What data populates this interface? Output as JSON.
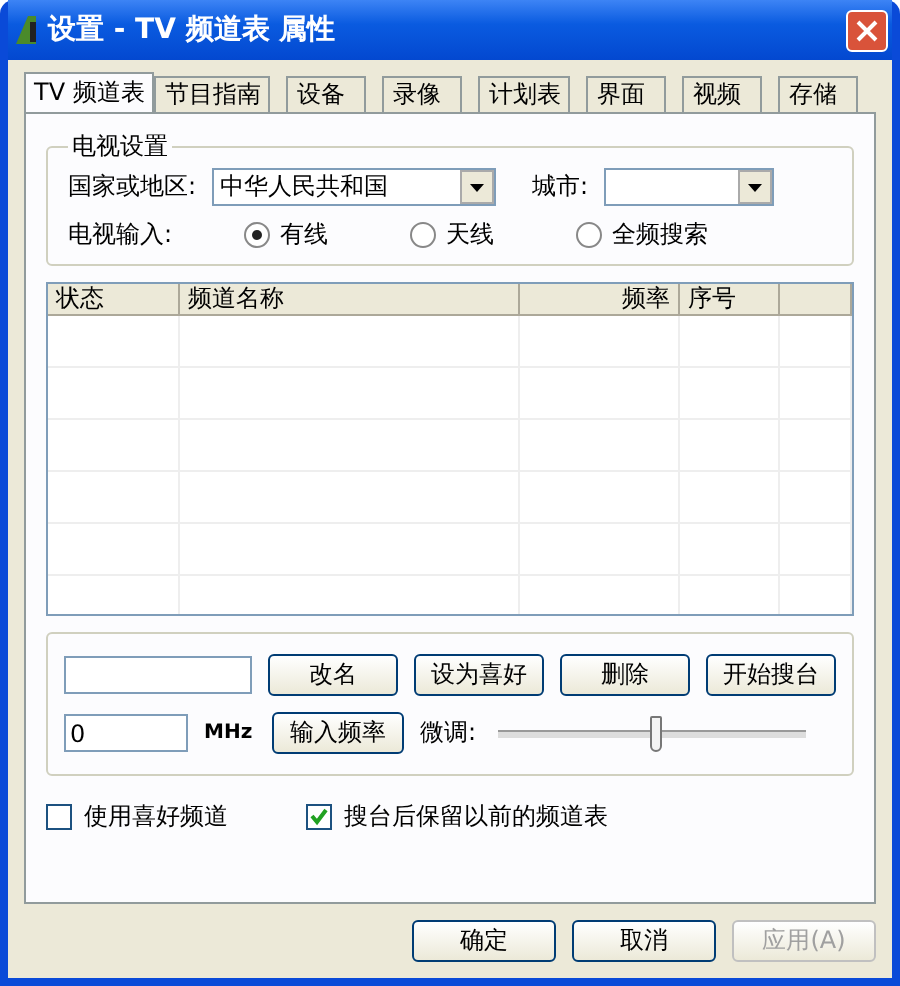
{
  "window": {
    "title": "设置 - TV 频道表 属性"
  },
  "tabs": [
    {
      "label": "TV 频道表",
      "selected": true
    },
    {
      "label": "节目指南",
      "selected": false
    },
    {
      "label": "设备",
      "selected": false
    },
    {
      "label": "录像",
      "selected": false
    },
    {
      "label": "计划表",
      "selected": false
    },
    {
      "label": "界面",
      "selected": false
    },
    {
      "label": "视频",
      "selected": false
    },
    {
      "label": "存储",
      "selected": false
    }
  ],
  "tv_settings": {
    "title": "电视设置",
    "country_label": "国家或地区:",
    "country_value": "中华人民共和国",
    "city_label": "城市:",
    "input_label": "电视输入:",
    "inputs": [
      {
        "label": "有线",
        "selected": true
      },
      {
        "label": "天线",
        "selected": false
      },
      {
        "label": "全频搜索",
        "selected": false
      }
    ]
  },
  "table": {
    "columns": [
      "状态",
      "频道名称",
      "频率",
      "序号"
    ]
  },
  "edit": {
    "buttons": [
      "改名",
      "设为喜好",
      "删除",
      "开始搜台"
    ],
    "frequency_value": "0",
    "unit": "MHz",
    "frequency_button": "输入频率",
    "fine_tune_label": "微调:",
    "fine_tune": {
      "level": 0.52
    }
  },
  "options": [
    {
      "label": "使用喜好频道",
      "checked": false
    },
    {
      "label": "搜台后保留以前的频道表",
      "checked": true
    }
  ],
  "buttons": [
    {
      "label": "确定",
      "disabled": false
    },
    {
      "label": "取消",
      "disabled": false
    },
    {
      "label": "应用(A)",
      "disabled": true
    }
  ]
}
